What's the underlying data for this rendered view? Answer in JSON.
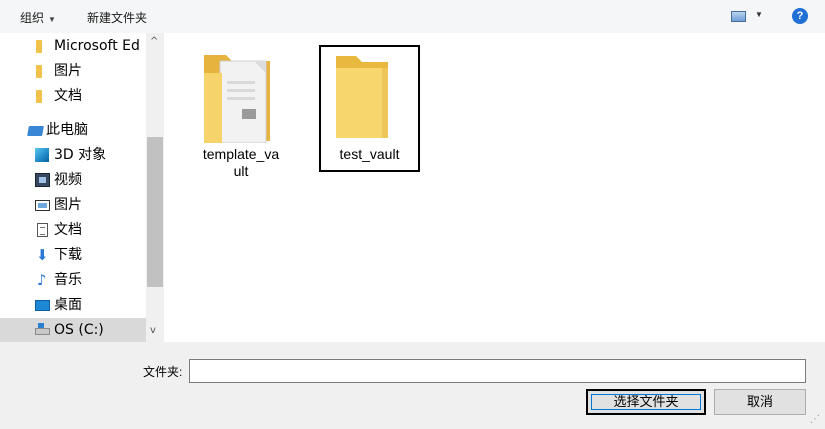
{
  "toolbar": {
    "organize_label": "组织",
    "new_folder_label": "新建文件夹",
    "help_label": "?"
  },
  "nav": {
    "items": [
      {
        "label": "Microsoft Ed",
        "icon": "folder-icon"
      },
      {
        "label": "图片",
        "icon": "folder-icon"
      },
      {
        "label": "文档",
        "icon": "folder-icon"
      },
      {
        "label": "此电脑",
        "icon": "computer-icon"
      },
      {
        "label": "3D 对象",
        "icon": "3d-objects-icon"
      },
      {
        "label": "视频",
        "icon": "videos-icon"
      },
      {
        "label": "图片",
        "icon": "pictures-icon"
      },
      {
        "label": "文档",
        "icon": "documents-icon"
      },
      {
        "label": "下载",
        "icon": "download-icon"
      },
      {
        "label": "音乐",
        "icon": "music-icon"
      },
      {
        "label": "桌面",
        "icon": "desktop-icon"
      },
      {
        "label": "OS (C:)",
        "icon": "drive-icon"
      }
    ],
    "selected_index": 11
  },
  "content": {
    "items": [
      {
        "name": "template_va\nult",
        "icon": "folder-with-markdown-file-icon",
        "selected": false
      },
      {
        "name": "test_vault",
        "icon": "folder-icon",
        "selected": true
      }
    ]
  },
  "footer": {
    "folder_label": "文件夹:",
    "folder_value": "",
    "select_button": "选择文件夹",
    "cancel_button": "取消"
  }
}
